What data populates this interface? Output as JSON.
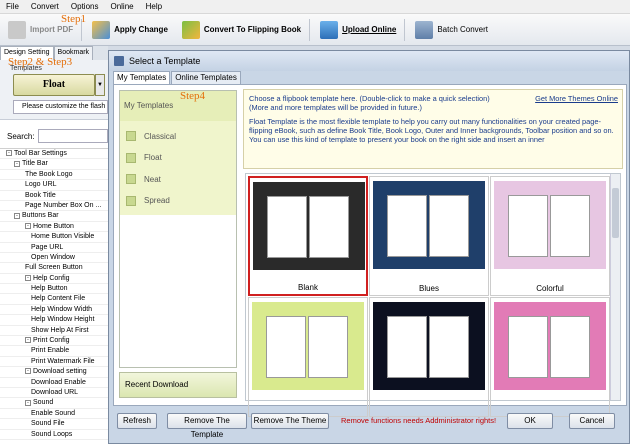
{
  "menu": [
    "File",
    "Convert",
    "Options",
    "Online",
    "Help"
  ],
  "toolbar": {
    "import_pdf": "Import PDF",
    "apply_change": "Apply Change",
    "convert": "Convert To Flipping Book",
    "upload": "Upload Online",
    "batch": "Batch Convert"
  },
  "steps": {
    "step1": "Step1",
    "step23": "Step2 & Step3",
    "step4": "Step4"
  },
  "left": {
    "tab_design": "Design Setting",
    "tab_bookmark": "Bookmark",
    "templates_label": "Templates",
    "template_value": "Float",
    "customize": "Please customize the flash",
    "search_label": "Search:"
  },
  "tree": [
    {
      "label": "Tool Bar Settings",
      "level": 0,
      "toggle": "-"
    },
    {
      "label": "Title Bar",
      "level": 1,
      "toggle": "-"
    },
    {
      "label": "The Book Logo",
      "level": 2
    },
    {
      "label": "Logo URL",
      "level": 2
    },
    {
      "label": "Book Title",
      "level": 2
    },
    {
      "label": "Page Number Box On ...",
      "level": 2
    },
    {
      "label": "Buttons Bar",
      "level": 1,
      "toggle": "-"
    },
    {
      "label": "Home Button",
      "level": 2,
      "toggle": "-"
    },
    {
      "label": "Home Button Visible",
      "level": 3
    },
    {
      "label": "Page URL",
      "level": 3
    },
    {
      "label": "Open Window",
      "level": 3
    },
    {
      "label": "Full Screen Button",
      "level": 2
    },
    {
      "label": "Help Config",
      "level": 2,
      "toggle": "-"
    },
    {
      "label": "Help Button",
      "level": 3
    },
    {
      "label": "Help Content File",
      "level": 3
    },
    {
      "label": "Help Window Width",
      "level": 3
    },
    {
      "label": "Help Window Height",
      "level": 3
    },
    {
      "label": "Show Help At First",
      "level": 3
    },
    {
      "label": "Print Config",
      "level": 2,
      "toggle": "-"
    },
    {
      "label": "Print Enable",
      "level": 3
    },
    {
      "label": "Print Watermark File",
      "level": 3
    },
    {
      "label": "Download setting",
      "level": 2,
      "toggle": "-"
    },
    {
      "label": "Download Enable",
      "level": 3
    },
    {
      "label": "Download URL",
      "level": 3
    },
    {
      "label": "Sound",
      "level": 2,
      "toggle": "-"
    },
    {
      "label": "Enable Sound",
      "level": 3
    },
    {
      "label": "Sound File",
      "level": 3
    },
    {
      "label": "Sound Loops",
      "level": 3
    }
  ],
  "dialog": {
    "title": "Select a Template",
    "tab_my": "My Templates",
    "tab_online": "Online Templates",
    "my_header": "My Templates",
    "my_items": [
      "Classical",
      "Float",
      "Neat",
      "Spread"
    ],
    "recent": "Recent Download",
    "desc1": "Choose a flipbook template here. (Double-click to make a quick selection)",
    "desc2": "(More and more templates will be provided in future.)",
    "more_link": "Get More Themes Online",
    "desc3": "Float Template is the most flexible template to help you carry out many functionalities on your created page-flipping eBook, such as define Book Title, Book Logo, Outer and Inner backgrounds, Toolbar position and so on. You can use this kind of template to present your book on the right side and insert an inner",
    "templates": [
      {
        "name": "Blank",
        "bg": "#2a2a2a",
        "selected": true
      },
      {
        "name": "Blues",
        "bg": "#1f3f6a"
      },
      {
        "name": "Colorful",
        "bg": "#e7c6e2"
      },
      {
        "name": "",
        "bg": "#d9ea8e"
      },
      {
        "name": "",
        "bg": "#0c1020"
      },
      {
        "name": "",
        "bg": "#e27bb6"
      }
    ],
    "buttons": {
      "refresh": "Refresh",
      "remove_template": "Remove The Template",
      "remove_theme": "Remove The Theme",
      "ok": "OK",
      "cancel": "Cancel"
    },
    "warning": "Remove functions needs Addministrator rights!"
  }
}
